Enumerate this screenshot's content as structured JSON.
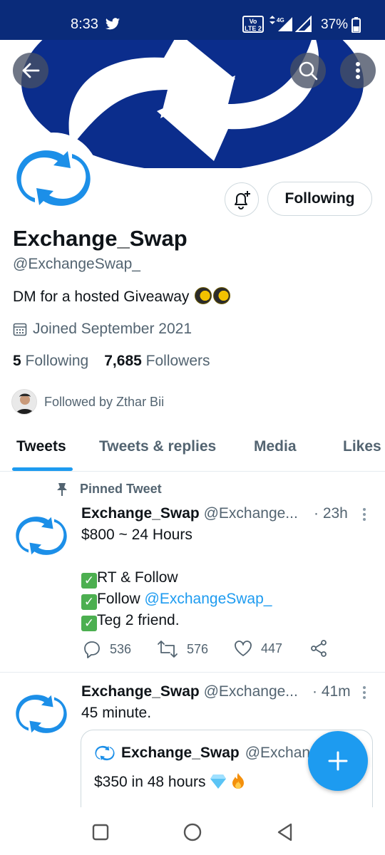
{
  "status_bar": {
    "time": "8:33",
    "volte_label": "Vo LTE 2",
    "battery_percent": "37%"
  },
  "profile": {
    "name": "Exchange_Swap",
    "handle": "@ExchangeSwap_",
    "bio": "DM for a hosted Giveaway",
    "joined": "Joined September 2021",
    "following_count": "5",
    "following_label": "Following",
    "followers_count": "7,685",
    "followers_label": "Followers",
    "followed_by": "Followed by Zthar Bii",
    "follow_button_label": "Following"
  },
  "tabs": [
    {
      "label": "Tweets",
      "active": true
    },
    {
      "label": "Tweets & replies",
      "active": false
    },
    {
      "label": "Media",
      "active": false
    },
    {
      "label": "Likes",
      "active": false
    }
  ],
  "tweets": [
    {
      "pinned_label": "Pinned Tweet",
      "name": "Exchange_Swap",
      "handle": "@Exchange...",
      "time": "· 23h",
      "lines": [
        "$800 ~ 24 Hours",
        "",
        "RT & Follow",
        "Follow ",
        "Teg 2 friend."
      ],
      "mention": "@ExchangeSwap_",
      "replies": "536",
      "retweets": "576",
      "likes": "447"
    },
    {
      "name": "Exchange_Swap",
      "handle": "@Exchange...",
      "time": "· 41m",
      "text": "45 minute.",
      "quote": {
        "name": "Exchange_Swap",
        "handle": "@Exchan",
        "text": "$350 in 48 hours"
      }
    }
  ],
  "colors": {
    "brand_blue": "#1d9bf0",
    "status_bar": "#0a2b7a",
    "banner_blue": "#0b2d8c"
  }
}
